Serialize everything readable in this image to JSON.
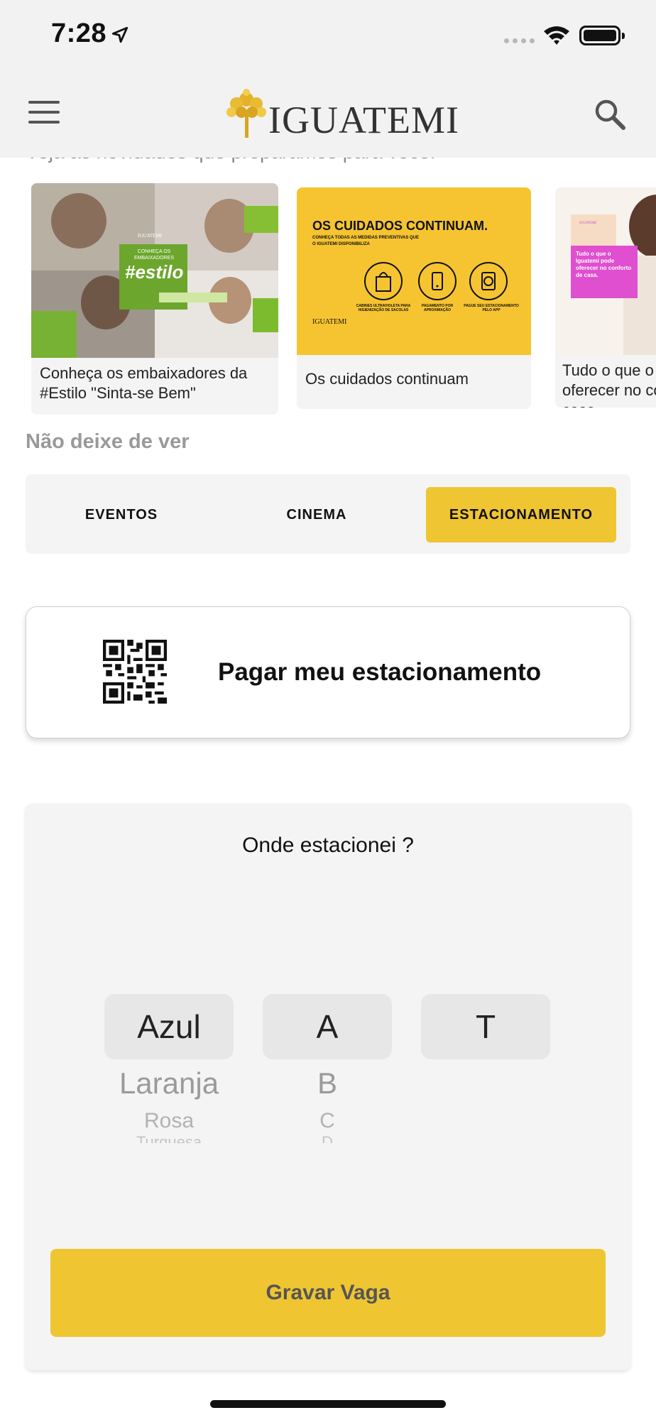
{
  "status_bar": {
    "time": "7:28"
  },
  "header": {
    "logo_text": "IGUATEMI"
  },
  "intro": {
    "text": "Veja as novidades que preparamos para você!"
  },
  "carousel": [
    {
      "caption": "Conheça os embaixadores da #Estilo \"Sinta-se Bem\"",
      "image_tag": "CONHEÇA OS EMBAIXADORES",
      "image_hashtag": "#estilo",
      "image_brand": "IGUATEMI"
    },
    {
      "caption": "Os cuidados continuam",
      "image_title": "OS CUIDADOS CONTINUAM.",
      "image_subtitle_1": "CONHEÇA TODAS AS MEDIDAS PREVENTIVAS QUE",
      "image_subtitle_2": "O IGUATEMI DISPONIBILIZA",
      "icon_captions": [
        "CABINES ULTRAVIOLETA PARA HIGIENIZAÇÃO DE SACOLAS",
        "PAGAMENTO POR APROXIMAÇÃO",
        "PAGUE SEU ESTACIONAMENTO PELO APP"
      ],
      "image_brand": "IGUATEMI"
    },
    {
      "caption": "Tudo o que o Iguatemi pode oferecer no conforto de casa.",
      "image_text": "Tudo o que o Iguatemi pode oferecer no conforto de casa.",
      "image_brand": "IGUATEMI"
    }
  ],
  "section": {
    "title": "Não deixe de ver"
  },
  "tabs": [
    {
      "label": "EVENTOS"
    },
    {
      "label": "CINEMA"
    },
    {
      "label": "ESTACIONAMENTO",
      "selected": true
    }
  ],
  "pay": {
    "label": "Pagar meu estacionamento"
  },
  "parking": {
    "title": "Onde estacionei ?",
    "color_picker": {
      "selected": "Azul",
      "options": [
        "Laranja",
        "Rosa",
        "Turquesa"
      ]
    },
    "letter_picker": {
      "selected": "A",
      "options": [
        "B",
        "C",
        "D"
      ]
    },
    "level_picker": {
      "selected": "T"
    },
    "save_label": "Gravar Vaga"
  },
  "colors": {
    "accent": "#efc532",
    "header_bg": "#f2f2f2"
  },
  "icons": [
    "menu-icon",
    "search-icon",
    "qr-code-icon",
    "location-arrow-icon",
    "wifi-icon",
    "battery-icon"
  ]
}
